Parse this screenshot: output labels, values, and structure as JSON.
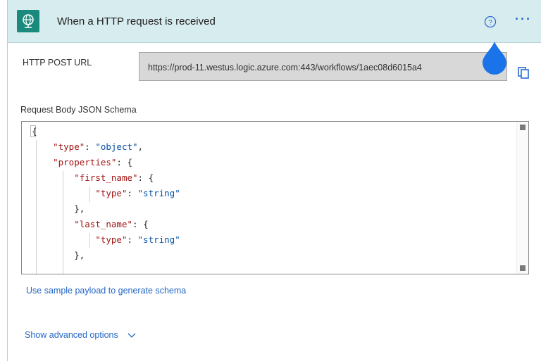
{
  "header": {
    "title": "When a HTTP request is received",
    "accent": "#1a8a7c"
  },
  "url": {
    "label": "HTTP POST URL",
    "value": "https://prod-11.westus.logic.azure.com:443/workflows/1aec08d6015a4"
  },
  "schema": {
    "label": "Request Body JSON Schema",
    "lines": [
      {
        "indent": 0,
        "key": "",
        "text": "{"
      },
      {
        "indent": 1,
        "key": "\"type\"",
        "sep": ": ",
        "str": "\"object\"",
        "tail": ","
      },
      {
        "indent": 1,
        "key": "\"properties\"",
        "sep": ": ",
        "str": "",
        "tail": "{"
      },
      {
        "indent": 2,
        "key": "\"first_name\"",
        "sep": ": ",
        "str": "",
        "tail": "{"
      },
      {
        "indent": 3,
        "key": "\"type\"",
        "sep": ": ",
        "str": "\"string\"",
        "tail": ""
      },
      {
        "indent": 2,
        "key": "",
        "text": "},"
      },
      {
        "indent": 2,
        "key": "\"last_name\"",
        "sep": ": ",
        "str": "",
        "tail": "{"
      },
      {
        "indent": 3,
        "key": "\"type\"",
        "sep": ": ",
        "str": "\"string\"",
        "tail": ""
      },
      {
        "indent": 2,
        "key": "",
        "text": "},"
      }
    ]
  },
  "links": {
    "sample": "Use sample payload to generate schema",
    "advanced": "Show advanced options"
  }
}
